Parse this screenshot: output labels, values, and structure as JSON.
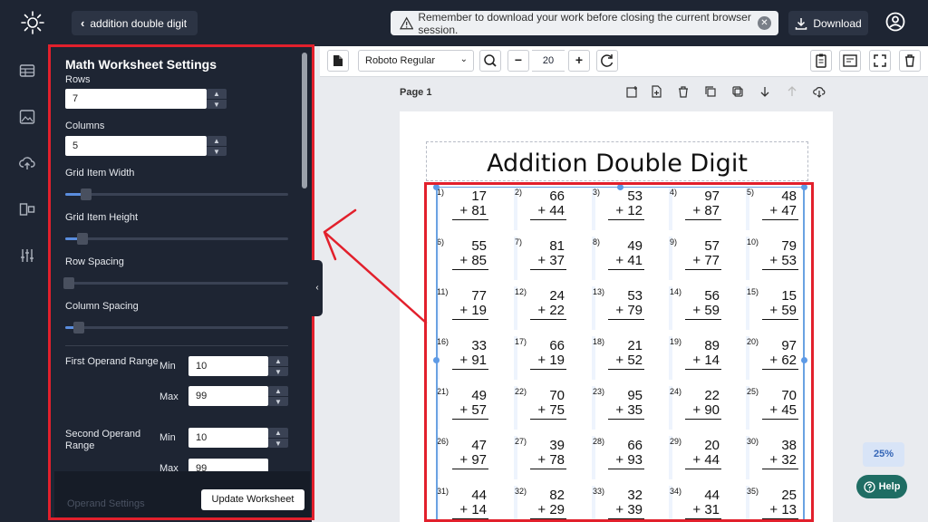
{
  "header": {
    "back_label": "addition double digit",
    "notice": "Remember to download your work before closing the current browser session.",
    "download_label": "Download"
  },
  "panel": {
    "title": "Math Worksheet Settings",
    "rows_label": "Rows",
    "rows_value": "7",
    "columns_label": "Columns",
    "columns_value": "5",
    "grid_item_width_label": "Grid Item Width",
    "grid_item_height_label": "Grid Item Height",
    "row_spacing_label": "Row Spacing",
    "column_spacing_label": "Column Spacing",
    "first_operand_label": "First Operand Range",
    "second_operand_label": "Second Operand Range",
    "min_label": "Min",
    "max_label": "Max",
    "first_min": "10",
    "first_max": "99",
    "second_min": "10",
    "second_max": "99",
    "operand_settings_label": "Operand Settings",
    "update_label": "Update Worksheet"
  },
  "toolbar": {
    "font": "Roboto Regular",
    "font_size": "20",
    "minus": "−",
    "plus": "+"
  },
  "page": {
    "label": "Page 1",
    "title": "Addition Double Digit"
  },
  "zoom_label": "25%",
  "help_label": "Help",
  "colors": {
    "annotation": "#e2202c",
    "selection": "#6aa2e2",
    "help": "#1f6d64"
  },
  "problems": [
    {
      "n": "1)",
      "a": "17",
      "b": "81"
    },
    {
      "n": "2)",
      "a": "66",
      "b": "44"
    },
    {
      "n": "3)",
      "a": "53",
      "b": "12"
    },
    {
      "n": "4)",
      "a": "97",
      "b": "87"
    },
    {
      "n": "5)",
      "a": "48",
      "b": "47"
    },
    {
      "n": "6)",
      "a": "55",
      "b": "85"
    },
    {
      "n": "7)",
      "a": "81",
      "b": "37"
    },
    {
      "n": "8)",
      "a": "49",
      "b": "41"
    },
    {
      "n": "9)",
      "a": "57",
      "b": "77"
    },
    {
      "n": "10)",
      "a": "79",
      "b": "53"
    },
    {
      "n": "11)",
      "a": "77",
      "b": "19"
    },
    {
      "n": "12)",
      "a": "24",
      "b": "22"
    },
    {
      "n": "13)",
      "a": "53",
      "b": "79"
    },
    {
      "n": "14)",
      "a": "56",
      "b": "59"
    },
    {
      "n": "15)",
      "a": "15",
      "b": "59"
    },
    {
      "n": "16)",
      "a": "33",
      "b": "91"
    },
    {
      "n": "17)",
      "a": "66",
      "b": "19"
    },
    {
      "n": "18)",
      "a": "21",
      "b": "52"
    },
    {
      "n": "19)",
      "a": "89",
      "b": "14"
    },
    {
      "n": "20)",
      "a": "97",
      "b": "62"
    },
    {
      "n": "21)",
      "a": "49",
      "b": "57"
    },
    {
      "n": "22)",
      "a": "70",
      "b": "75"
    },
    {
      "n": "23)",
      "a": "95",
      "b": "35"
    },
    {
      "n": "24)",
      "a": "22",
      "b": "90"
    },
    {
      "n": "25)",
      "a": "70",
      "b": "45"
    },
    {
      "n": "26)",
      "a": "47",
      "b": "97"
    },
    {
      "n": "27)",
      "a": "39",
      "b": "78"
    },
    {
      "n": "28)",
      "a": "66",
      "b": "93"
    },
    {
      "n": "29)",
      "a": "20",
      "b": "44"
    },
    {
      "n": "30)",
      "a": "38",
      "b": "32"
    },
    {
      "n": "31)",
      "a": "44",
      "b": "14"
    },
    {
      "n": "32)",
      "a": "82",
      "b": "29"
    },
    {
      "n": "33)",
      "a": "32",
      "b": "39"
    },
    {
      "n": "34)",
      "a": "44",
      "b": "31"
    },
    {
      "n": "35)",
      "a": "25",
      "b": "13"
    }
  ],
  "operator": "+"
}
